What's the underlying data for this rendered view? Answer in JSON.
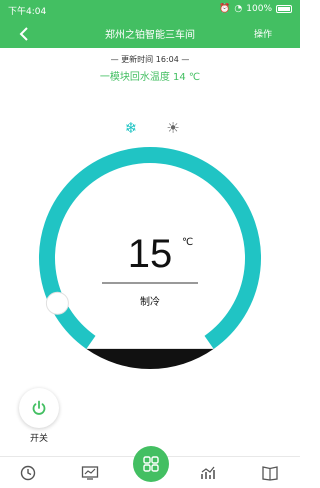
{
  "status_bar": {
    "time": "下午4:04",
    "battery": "100%"
  },
  "app_bar": {
    "title": "郑州之铂智能三车间",
    "action": "操作"
  },
  "info": {
    "update_label": "— 更新时间",
    "update_time": "16:04 —",
    "temp_label": "一模块回水温度",
    "temp_value": "14 ℃"
  },
  "thermostat": {
    "setpoint": "15",
    "unit": "℃",
    "mode": "制冷",
    "level": 0.1,
    "minus_label": "−",
    "plus_label": "+"
  },
  "power": {
    "label": "开关"
  },
  "colors": {
    "primary": "#43bf62",
    "dial": "#20c4c4",
    "dial_base": "#111111"
  },
  "icons": {
    "back": "chevron-left-icon",
    "cool": "snowflake-icon",
    "heat": "sun-icon",
    "power": "power-icon",
    "nav": [
      "clock-icon",
      "monitor-icon",
      "grid-icon",
      "chart-icon",
      "book-icon"
    ]
  }
}
